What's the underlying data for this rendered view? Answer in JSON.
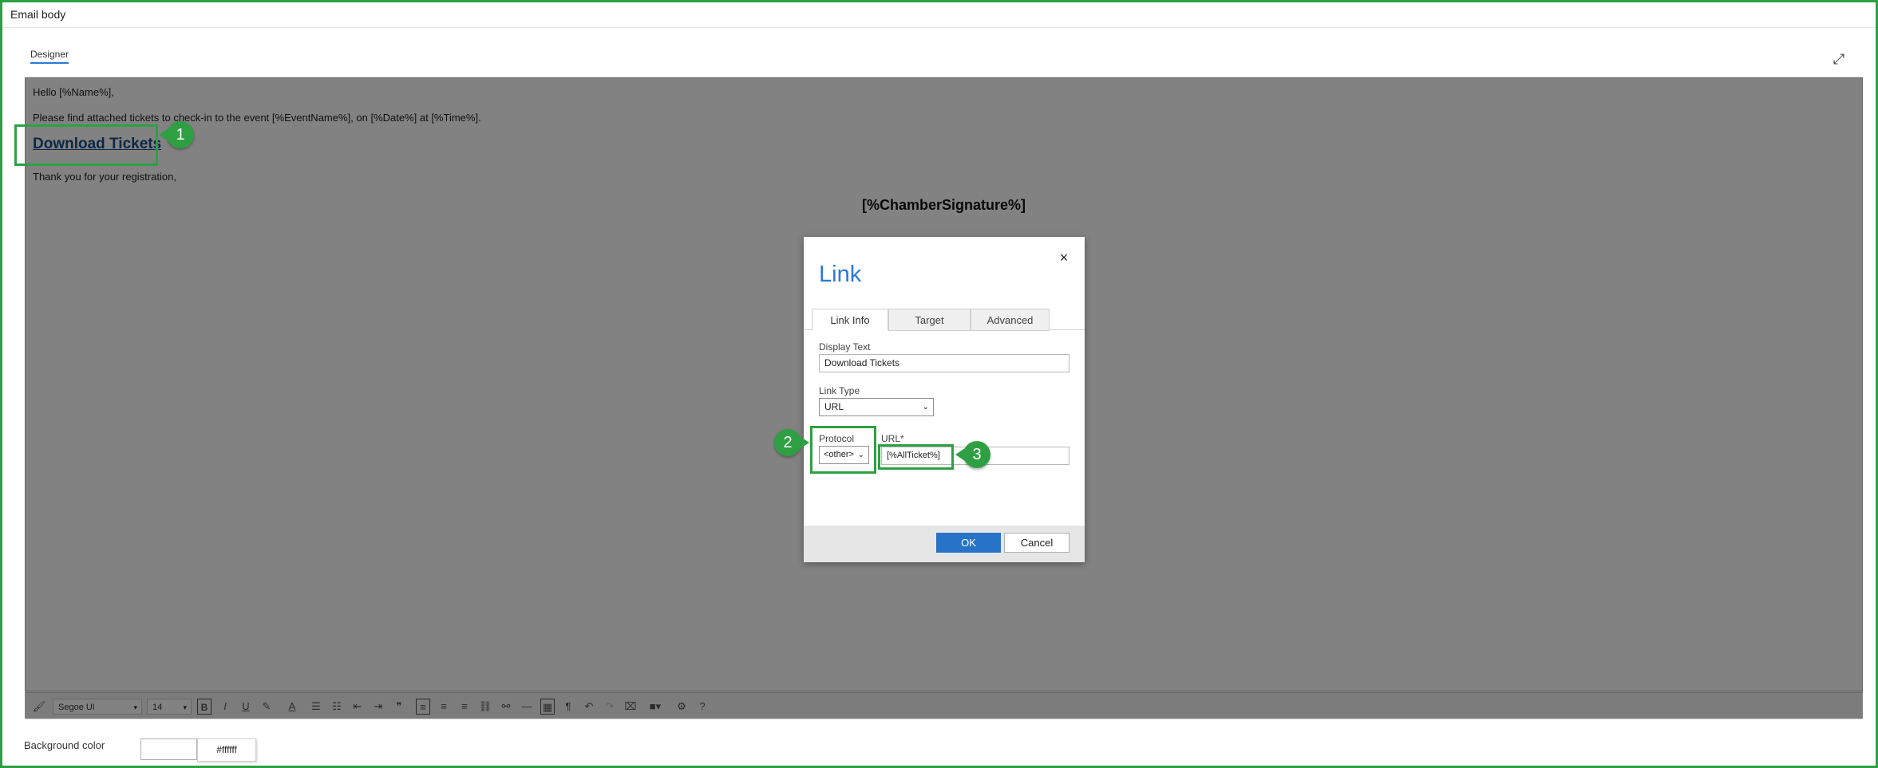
{
  "panel": {
    "title": "Email body",
    "designer_tab": "Designer"
  },
  "icons": {
    "expand": "expand-icon",
    "close": "close-icon"
  },
  "editor": {
    "greeting": "Hello [%Name%],",
    "body_line": "Please find attached tickets to check-in to the event [%EventName%], on [%Date%] at [%Time%].",
    "link_text": "Download Tickets",
    "thanks": "Thank you for your registration,",
    "signature": "[%ChamberSignature%]"
  },
  "toolbar": {
    "font_family": "Segoe UI",
    "font_size": "14",
    "bold": "B",
    "italic": "I",
    "underline": "U",
    "font_color": "A",
    "help": "?"
  },
  "dialog": {
    "title": "Link",
    "close": "×",
    "tabs": [
      "Link Info",
      "Target",
      "Advanced"
    ],
    "display_text_label": "Display Text",
    "display_text_value": "Download Tickets",
    "link_type_label": "Link Type",
    "link_type_value": "URL",
    "protocol_label": "Protocol",
    "protocol_value": "<other>",
    "url_label": "URL*",
    "url_value": "[%AllTicket%]",
    "ok": "OK",
    "cancel": "Cancel"
  },
  "annotations": {
    "b1": "1",
    "b2": "2",
    "b3": "3"
  },
  "background": {
    "label": "Background color",
    "value": "#ffffff"
  },
  "colors": {
    "accent": "#2b79d6",
    "annotation": "#2ea043",
    "ok_button": "#2673c8"
  }
}
